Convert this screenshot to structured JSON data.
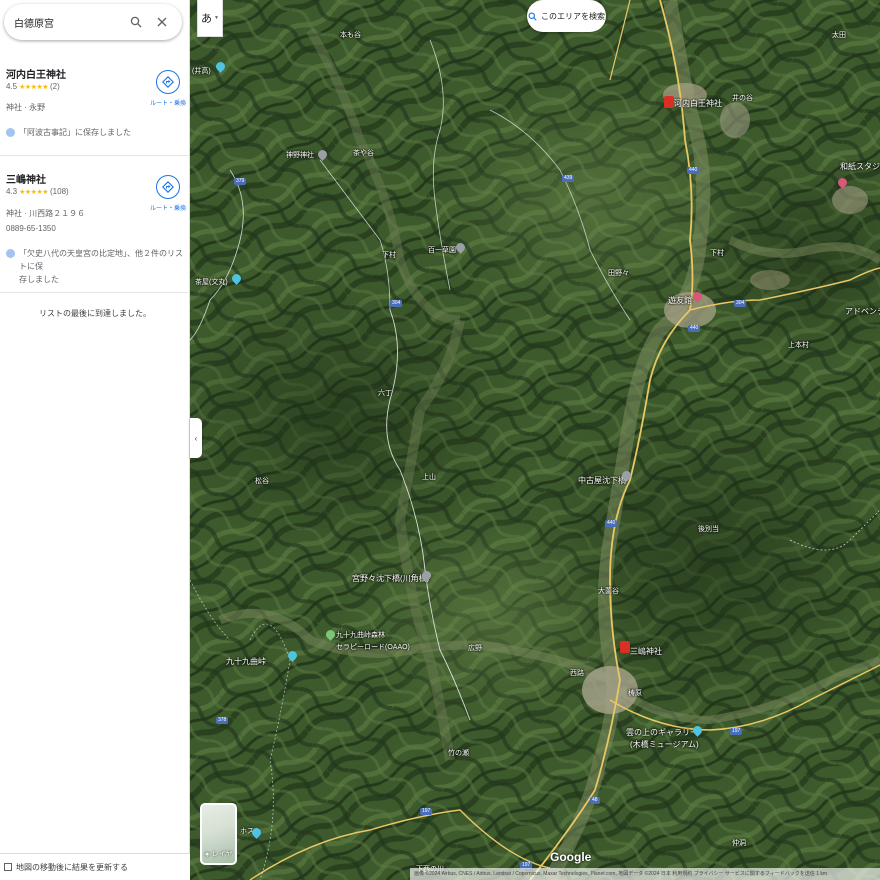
{
  "search": {
    "query": "白德原宫"
  },
  "results": [
    {
      "title": "河内白王神社",
      "rating": "4.5",
      "stars": "★★★★★",
      "reviews": "(2)",
      "category": "神社 · 永野",
      "route_label": "ルート・乗換",
      "saved": "「阿波古事記」に保存しました"
    },
    {
      "title": "三嶋神社",
      "rating": "4.3",
      "stars": "★★★★★",
      "reviews": "(108)",
      "category": "神社 · 川西路２１９６",
      "phone": "0889-65-1350",
      "route_label": "ルート・乗換",
      "saved_line1": "「欠史八代の天皇宮の比定地」、他２件のリストに保",
      "saved_line2": "存しました"
    }
  ],
  "end_of_list": "リストの最後に到達しました。",
  "update_on_move": "地図の移動後に結果を更新する",
  "map": {
    "ime_label": "あ",
    "search_area": "このエリアを検索",
    "layers": "レイヤ",
    "google": "Google",
    "attribution": "画像 ©2024 Airbus, CNES / Airbus, Landsat / Copernicus, Maxar Technologies, Planet.com, 地図データ ©2024  日本  利用規約  プライバシー  サービスに関するフィードバックを送信  1 km",
    "labels": {
      "ino": "(井高)",
      "motoya": "本も谷",
      "kawachi_shrine": "河内白王神社",
      "inotani": "井の谷",
      "ota": "太田",
      "washi_studio": "和紙スタジオ",
      "jinno": "神野神社",
      "chayatani": "茶や谷",
      "hyakuichi": "百一草園",
      "shimo": "下村",
      "tanono": "田野々",
      "yusukan": "遊友館",
      "adven": "アドベンチ",
      "chaya_bunmaru": "茶屋(文丸)",
      "kamimura": "上本村",
      "rokuta": "六丁",
      "ueyama": "上山",
      "matsutani": "松谷",
      "nakafuru": "中古屋沈下橋",
      "gotoku": "後別当",
      "miyanosawa": "宮野々沈下橋(川角橋)",
      "otani": "大薗谷",
      "kujukumagari_forest": "九十九曲峠森林",
      "therapy_road": "セラピーロード(OAAO)",
      "kujukumagari": "九十九曲峠",
      "hirose": "広野",
      "nishiji": "西路",
      "mishima": "三嶋神社",
      "kunino": "梼原",
      "kumo_no_ue": "雲の上のギャラリー",
      "kiyohashi": "(木橋ミュージアム)",
      "takenose": "竹の瀬",
      "shimoni": "下西の川",
      "nakamine": "仲洞",
      "hosuto": "ホスト"
    },
    "routes": [
      "379",
      "439",
      "304",
      "440",
      "197",
      "48",
      "378"
    ]
  },
  "colors": {
    "accent": "#1a73e8",
    "star": "#fbbc04",
    "poi_red": "#d93025"
  }
}
